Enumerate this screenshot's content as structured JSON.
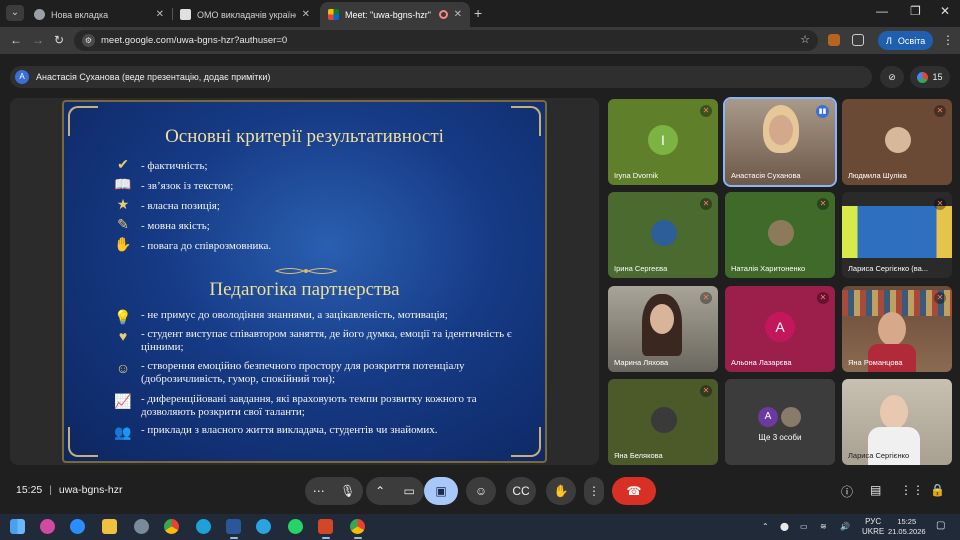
{
  "browser": {
    "tabs": [
      {
        "title": "Нова вкладка"
      },
      {
        "title": "ОМО викладачів української і"
      },
      {
        "title": "Meet: \"uwa-bgns-hzr\""
      }
    ],
    "url": "meet.google.com/uwa-bgns-hzr?authuser=0",
    "profile_initial": "Л",
    "profile_label": "Освіта",
    "window_controls": [
      "minimize-icon",
      "restore-icon",
      "close-icon"
    ]
  },
  "meet": {
    "presenter_initial": "А",
    "presenter_banner": "Анастасія Суханова (веде презентацію, додає примітки)",
    "participant_count": "15",
    "meeting_time": "15:25",
    "meeting_code": "uwa-bgns-hzr"
  },
  "slide": {
    "title1": "Основні критерії результативності",
    "list1": [
      {
        "icon": "check-badge-icon",
        "text": "- фактичність;"
      },
      {
        "icon": "book-icon",
        "text": "- зв’язок із текстом;"
      },
      {
        "icon": "star-badge-icon",
        "text": "- власна позиція;"
      },
      {
        "icon": "feather-icon",
        "text": "- мовна якість;"
      },
      {
        "icon": "handshake-icon",
        "text": "- повага до співрозмовника."
      }
    ],
    "title2": "Педагогіка партнерства",
    "list2": [
      {
        "icon": "lightbulb-icon",
        "text": "- не примус до оволодіння знаннями, а зацікавленість, мотивація;"
      },
      {
        "icon": "hands-heart-icon",
        "text": "- студент виступає співавтором заняття, де його думка, емоції та ідентичність є цінними;"
      },
      {
        "icon": "smile-icon",
        "text": "- створення емоційно безпечного простору для розкриття потенціалу (доброзичливість, гумор, спокійний тон);"
      },
      {
        "icon": "growth-chart-icon",
        "text": "- диференційовані завдання, які враховують темпи розвитку кожного та дозволяють розкрити свої таланти;"
      },
      {
        "icon": "people-star-icon",
        "text": "- приклади з власного життя викладача, студентів чи знайомих."
      }
    ]
  },
  "participants": [
    {
      "name": "Iryna Dvornik",
      "avatar_letter": "I",
      "color": "#7cb342",
      "type": "letter",
      "bg": "#5f7f2a"
    },
    {
      "name": "Анастасія Суханова",
      "type": "video",
      "bg": "#8a7060",
      "speaking": true
    },
    {
      "name": "Людмила Шуліка",
      "type": "photo",
      "bg": "#6b4a35",
      "color": "#d7b89a"
    },
    {
      "name": "Ірина Сергеєва",
      "type": "photo",
      "bg": "#4a6a2f",
      "color": "#2e5e9a"
    },
    {
      "name": "Наталія Харитоненко",
      "type": "photo",
      "bg": "#3f6a2a",
      "color": "#8c7b5a"
    },
    {
      "name": "Лариса Сергієнко (ва...",
      "type": "screen",
      "bg": "#2a2a2a"
    },
    {
      "name": "Марина Ляхова",
      "type": "video",
      "bg": "#8c8a80"
    },
    {
      "name": "Альона Лазарєва",
      "avatar_letter": "A",
      "color": "#c2185b",
      "type": "letter",
      "bg": "#9c1e4a"
    },
    {
      "name": "Яна Романцова",
      "type": "video",
      "bg": "#7a5a48"
    },
    {
      "name": "Яна Белякова",
      "type": "photo",
      "bg": "#4c5a2a",
      "color": "#3a3a3a"
    },
    {
      "name": "Ще 3 особи",
      "type": "more",
      "bg": "#3c3c3c",
      "avatar_letter": "A",
      "color": "#6a3aa0"
    },
    {
      "name": "Лариса Сергієнко",
      "type": "video",
      "bg": "#b8b0a0"
    }
  ],
  "controls": {
    "more_options_icon": "ellipsis-icon",
    "mic_icon": "microphone-icon",
    "chevron_icon": "chevron-up-icon",
    "camera_icon": "camera-icon",
    "present_icon": "present-icon",
    "emoji_icon": "emoji-icon",
    "captions_icon": "captions-icon",
    "hand_icon": "raise-hand-icon",
    "more_icon": "more-vert-icon",
    "end_icon": "end-call-icon"
  },
  "taskbar": {
    "language": "РУС",
    "layout": "UKRE",
    "time": "15:25",
    "date": "21.05.2026"
  }
}
